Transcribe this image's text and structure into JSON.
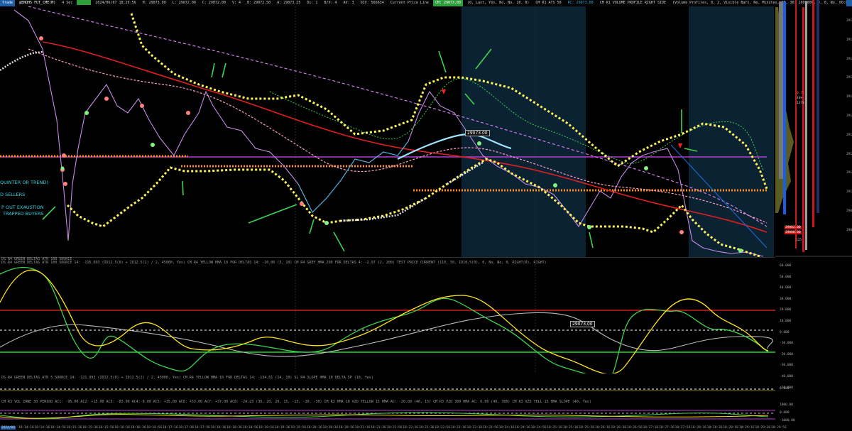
{
  "header": {
    "items": [
      "Trade",
      "@ENQH5 FUT_CME(M)",
      "4 Sec",
      "",
      "2024/06/07 18:29:56",
      "H: 29073.00",
      "L: 29072.00",
      "C: 29072.00",
      "V: 4",
      "B: 29072.50",
      "A: 29073.25",
      "Di: 1",
      "B/V: 4",
      "AV: 3",
      "OIV: 566634",
      "Current Price Line",
      "CM: 29073.00",
      "(0, Last, Yes, No, No, 10, 0)",
      "CM R1 ATS 50",
      "PC: 29073.00",
      "CM R1 VOLUME PROFILE RIGHT SIDE",
      "(Volume Profiles, 0, 2, Visible Bars, No, Minutes, 15, 30, 1000000, 0, 0, No, 00:00:000, No, No, Period Length, 10, Yes, None, 0, No, Total Volume, Yes, No)"
    ],
    "colors": {
      "green": "#3ed34f",
      "red": "#ff3b3b"
    }
  },
  "main": {
    "annotations": [
      "QUINTER OR TREND)",
      "D SELLERS",
      "P OUT EXAUSTION",
      "TRAPPED BUYERS"
    ],
    "price_tag": "29073.00",
    "study_labels": "DS R4 GREEN DELTAS ATR 100 SOURCE"
  },
  "price_axis": {
    "labels": [
      "29190.00",
      "29180.00",
      "29170.00",
      "29160.00",
      "29150.00",
      "29140.00",
      "29130.00",
      "29120.00",
      "29110.00",
      "29100.00",
      "29090.00",
      "29080.00"
    ],
    "bid_ask_tags": [
      "29082.00",
      "29080.00"
    ]
  },
  "profile_small": {
    "labels": [
      "125",
      "0.75",
      "44%",
      "1378"
    ]
  },
  "osc1": {
    "header": "DS R4 GREEN DELTAS ATR 100 SOURCE  14: -116.693  (ID12.5(0) + ID12.5(2) / 2, 45000, Yes)  CM R4 YELLOW HMA 10 FOR DELTAS  14: -10.00  (3, 10)  CM R4 GREY HMA 200 FOR DELTAS  4: -2.97  (2, 200)  TEST PRICE CURRENT  (110, 50, ID10.5(0), 0, No, No, 0, RIGHT(0), RIGHT)",
    "price_tag": "29073.00",
    "scale": [
      "60.000",
      "50.000",
      "40.000",
      "30.000",
      "20.000",
      "10.000",
      "0.000",
      "-10.000",
      "-20.000",
      "-30.000",
      "-40.000",
      "-50.000"
    ]
  },
  "osc2": {
    "header": "DS R4 GREEN DELTAS ATR 5 SOURCE  14: -121.993  (ID12.5(0) + ID12.5(2) / 2, 45000, Yes)  CM R4 YELLOW HMA 10 FOR DELTAS  14: -134.61  (14, 10)  SL R4 SLOPE HMA 10 DELTA SP  (18, Yes)",
    "scale": "0.000"
  },
  "osc3": {
    "header": "CM R3 VOL ZONE 30 PERIOD  AC1: -95.00  AC2: +15.00  AC3: -83.00  AC4: 0.00  AC5: +35.00  AC6: +53.00  AC7: +37.00  AC8: -24.23   (30, 20, 20, 15, -15, -20, -30)  CM R3 HMA 10 VZO YELLOW 15 HMA   AC: -20.00   (40, 15)  CM R3 VZO  300 HMA  AC: 6.00  (40, 300)  CM R3 VZO YELL 15  HMA SLOPE  (40, Yes)",
    "scale": [
      "1000.00",
      "0.000",
      "-1000.00"
    ]
  },
  "time_axis": {
    "start_label": "2024/06",
    "labels": [
      "18:14:16",
      "18:14:36",
      "18:14:56",
      "18:15:16",
      "18:15:36",
      "18:15:56",
      "18:16:16",
      "18:16:36",
      "18:16:56",
      "18:17:16",
      "18:17:36",
      "18:17:56",
      "18:18:16",
      "18:18:36",
      "18:18:56",
      "18:19:16",
      "18:19:36",
      "18:19:56",
      "18:20:16",
      "18:20:36",
      "18:20:56",
      "18:21:16",
      "18:21:36",
      "18:21:56",
      "18:22:16",
      "18:22:36",
      "18:22:56",
      "18:23:16",
      "18:23:36",
      "18:23:56",
      "18:24:16",
      "18:24:36",
      "18:24:56",
      "18:25:16",
      "18:25:36",
      "18:25:56",
      "18:26:16",
      "18:26:36",
      "18:26:56",
      "18:27:16",
      "18:27:36",
      "18:27:56",
      "18:28:16",
      "18:28:36",
      "18:28:56",
      "18:29:16",
      "18:29:36",
      "18:29:56"
    ]
  }
}
